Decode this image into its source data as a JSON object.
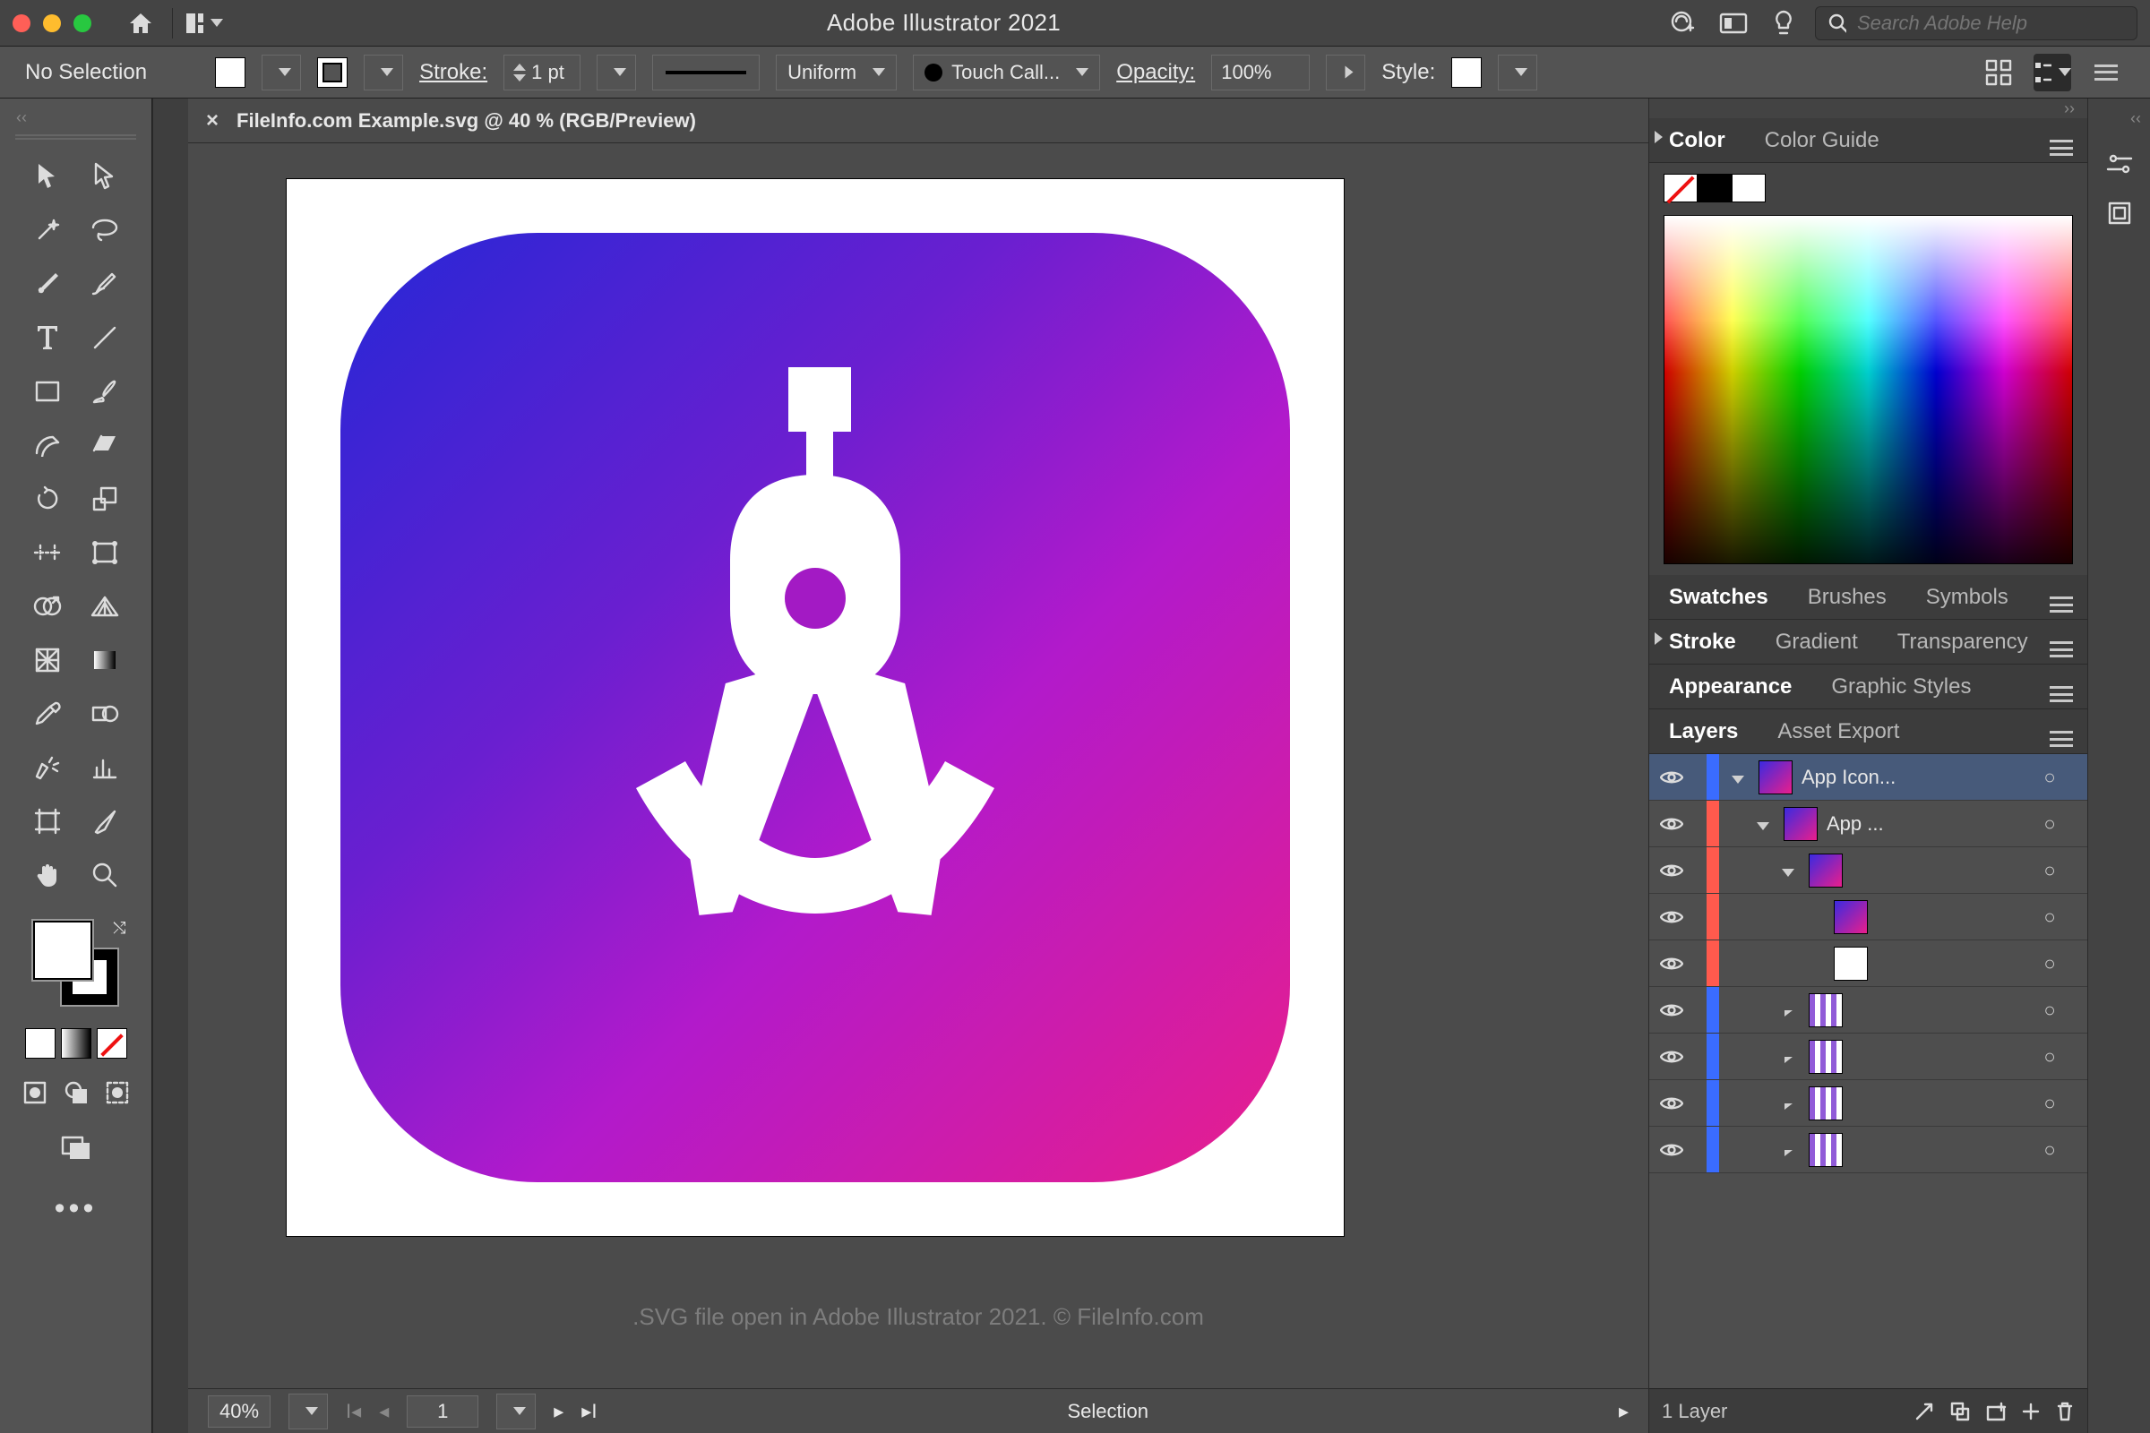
{
  "titlebar": {
    "title": "Adobe Illustrator 2021",
    "search_placeholder": "Search Adobe Help"
  },
  "options": {
    "selection": "No Selection",
    "stroke_label": "Stroke:",
    "stroke_value": "1 pt",
    "profile": "Uniform",
    "brush": "Touch Call...",
    "opacity_label": "Opacity:",
    "opacity_value": "100%",
    "style_label": "Style:"
  },
  "document": {
    "tab": "FileInfo.com Example.svg @ 40 % (RGB/Preview)",
    "caption": ".SVG file open in Adobe Illustrator 2021. © FileInfo.com"
  },
  "bottombar": {
    "zoom": "40%",
    "page": "1",
    "mode": "Selection"
  },
  "panels": {
    "color": {
      "tab": "Color",
      "tab2": "Color Guide"
    },
    "swatches": {
      "tabs": [
        "Swatches",
        "Brushes",
        "Symbols"
      ]
    },
    "stroke": {
      "tabs": [
        "Stroke",
        "Gradient",
        "Transparency"
      ]
    },
    "appearance": {
      "tabs": [
        "Appearance",
        "Graphic Styles"
      ]
    },
    "layers": {
      "tabs": [
        "Layers",
        "Asset Export"
      ]
    }
  },
  "layers": {
    "rows": [
      {
        "name": "App Icon...",
        "indent": 0,
        "color": "blue",
        "twist": "down",
        "thumb": "grad",
        "sel": true
      },
      {
        "name": "App ...",
        "indent": 1,
        "color": "red",
        "twist": "down",
        "thumb": "grad"
      },
      {
        "name": "",
        "indent": 2,
        "color": "red",
        "twist": "down",
        "thumb": "grad"
      },
      {
        "name": "",
        "indent": 3,
        "color": "red",
        "twist": "",
        "thumb": "grad"
      },
      {
        "name": "",
        "indent": 3,
        "color": "red",
        "twist": "",
        "thumb": "white"
      },
      {
        "name": "",
        "indent": 2,
        "color": "blue",
        "twist": "right",
        "thumb": "pp"
      },
      {
        "name": "",
        "indent": 2,
        "color": "blue",
        "twist": "right",
        "thumb": "pp"
      },
      {
        "name": "",
        "indent": 2,
        "color": "blue",
        "twist": "right",
        "thumb": "pp"
      },
      {
        "name": "",
        "indent": 2,
        "color": "blue",
        "twist": "right",
        "thumb": "pp"
      }
    ],
    "footer": "1 Layer"
  }
}
